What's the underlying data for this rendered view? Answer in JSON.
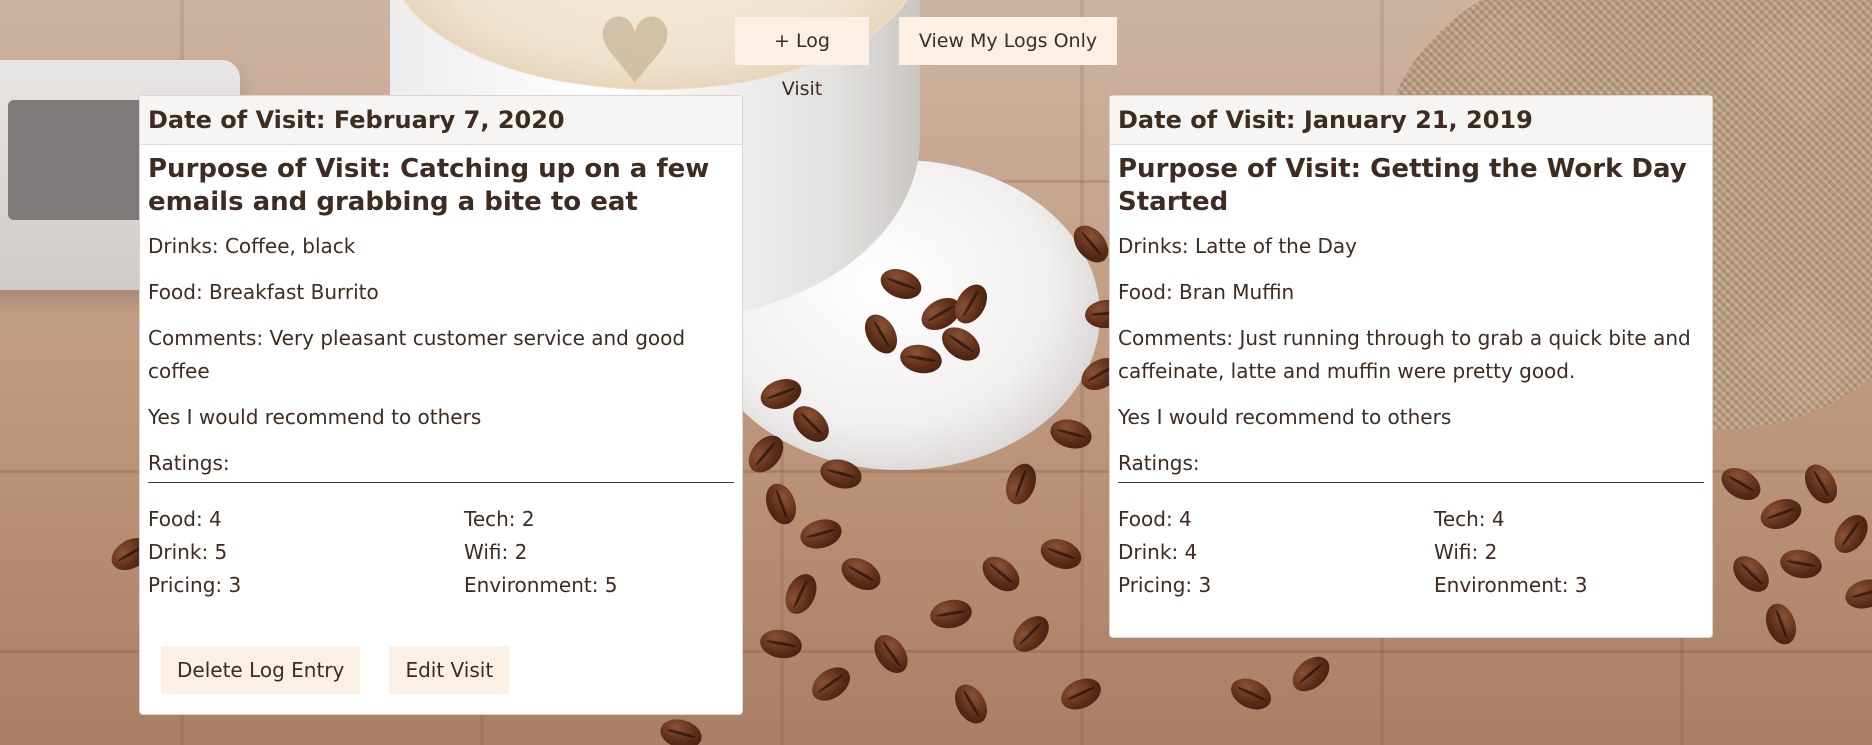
{
  "toolbar": {
    "log_visit_label": "+ Log Visit",
    "view_my_logs_label": "View My Logs Only"
  },
  "entries": [
    {
      "date": "Date of Visit: February 7, 2020",
      "purpose": "Purpose of Visit: Catching up on a few emails and grabbing a bite to eat",
      "drinks": "Drinks: Coffee, black",
      "food": "Food: Breakfast Burrito",
      "comments": "Comments: Very pleasant customer service and good coffee",
      "recommend": "Yes I would recommend to others",
      "ratings_label": "Ratings:",
      "ratings": {
        "food": "Food: 4",
        "tech": "Tech: 2",
        "drink": "Drink: 5",
        "wifi": "Wifi: 2",
        "pricing": "Pricing: 3",
        "environment": "Environment: 5"
      },
      "actions": {
        "delete_label": "Delete Log Entry",
        "edit_label": "Edit Visit"
      }
    },
    {
      "date": "Date of Visit: January 21, 2019",
      "purpose": "Purpose of Visit: Getting the Work Day Started",
      "drinks": "Drinks: Latte of the Day",
      "food": "Food: Bran Muffin",
      "comments": "Comments: Just running through to grab a quick bite and caffeinate, latte and muffin were pretty good.",
      "recommend": "Yes I would recommend to others",
      "ratings_label": "Ratings:",
      "ratings": {
        "food": "Food: 4",
        "tech": "Tech: 4",
        "drink": "Drink: 4",
        "wifi": "Wifi: 2",
        "pricing": "Pricing: 3",
        "environment": "Environment: 3"
      }
    }
  ]
}
